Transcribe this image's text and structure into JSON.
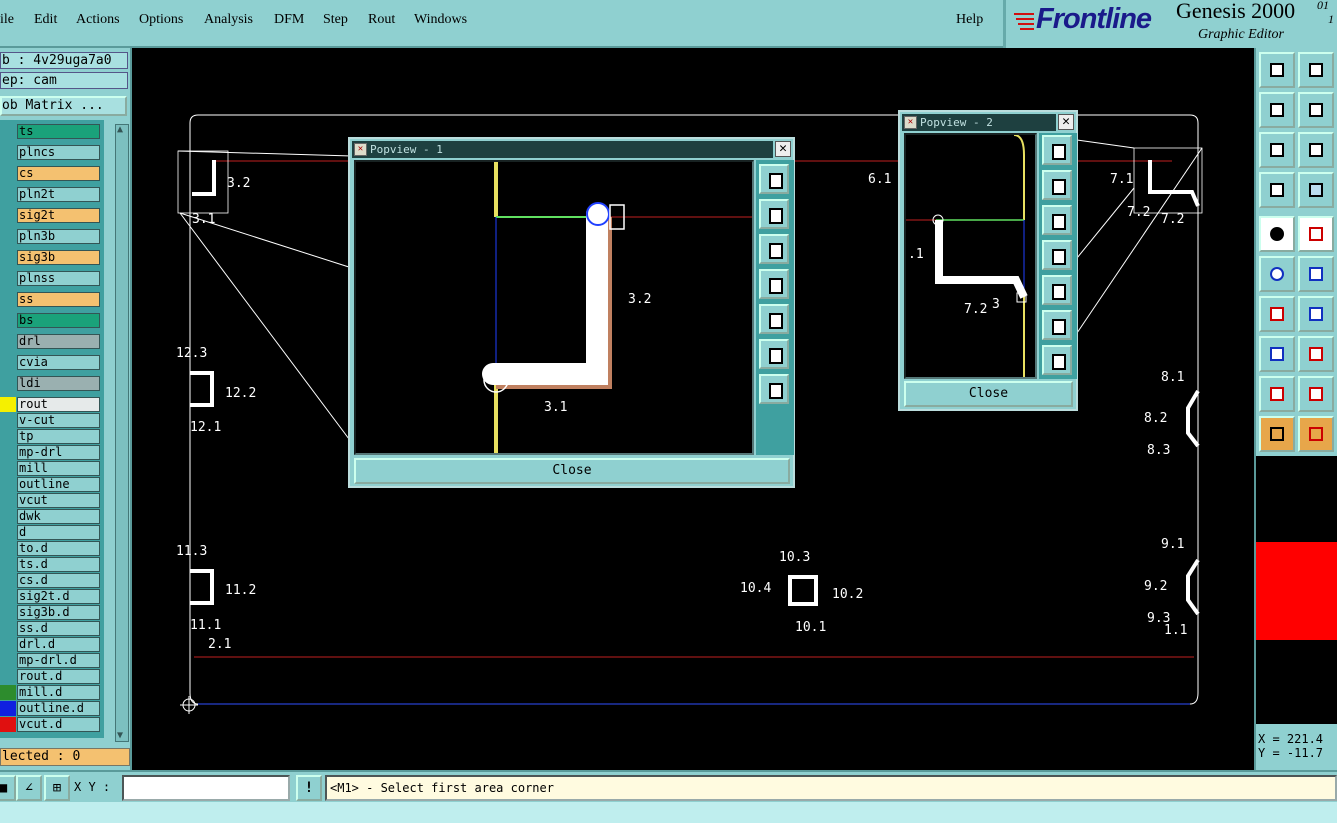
{
  "menu": [
    "File",
    "Edit",
    "Actions",
    "Options",
    "Analysis",
    "DFM",
    "Step",
    "Rout",
    "Windows"
  ],
  "menu_display": [
    "ile",
    "Edit",
    "Actions",
    "Options",
    "Analysis",
    "DFM",
    "Step",
    "Rout",
    "Windows"
  ],
  "help": "Help",
  "brand": {
    "logo": "Frontline",
    "product": "Genesis 2000",
    "ver1": "01",
    "ver2": "1",
    "subtitle": "Graphic Editor"
  },
  "left": {
    "job": "b : 4v29uga7a0",
    "step": "ep: cam",
    "matrix": "ob Matrix ...",
    "layers": [
      {
        "name": "ts",
        "color": "#1aa27a"
      },
      {
        "name": "plncs",
        "color": "#8fd0d0"
      },
      {
        "name": "cs",
        "color": "#f4c170"
      },
      {
        "name": "pln2t",
        "color": "#8fd0d0"
      },
      {
        "name": "sig2t",
        "color": "#f4c170"
      },
      {
        "name": "pln3b",
        "color": "#8fd0d0"
      },
      {
        "name": "sig3b",
        "color": "#f4c170"
      },
      {
        "name": "plnss",
        "color": "#8fd0d0"
      },
      {
        "name": "ss",
        "color": "#f4c170"
      },
      {
        "name": "bs",
        "color": "#1aa27a"
      },
      {
        "name": "drl",
        "color": "#9ab0b0"
      },
      {
        "name": "cvia",
        "color": "#8fd0d0"
      },
      {
        "name": "ldi",
        "color": "#9ab0b0"
      },
      {
        "name": "rout",
        "color": "#e6eaea"
      },
      {
        "name": "v-cut",
        "color": "#8fd0d0"
      },
      {
        "name": "tp",
        "color": "#8fd0d0"
      },
      {
        "name": "mp-drl",
        "color": "#8fd0d0"
      },
      {
        "name": "mill",
        "color": "#8fd0d0"
      },
      {
        "name": "outline",
        "color": "#8fd0d0"
      },
      {
        "name": "vcut",
        "color": "#8fd0d0"
      },
      {
        "name": "dwk",
        "color": "#8fd0d0"
      },
      {
        "name": "d",
        "color": "#8fd0d0"
      },
      {
        "name": "to.d",
        "color": "#8fd0d0"
      },
      {
        "name": "ts.d",
        "color": "#8fd0d0"
      },
      {
        "name": "cs.d",
        "color": "#8fd0d0"
      },
      {
        "name": "sig2t.d",
        "color": "#8fd0d0"
      },
      {
        "name": "sig3b.d",
        "color": "#8fd0d0"
      },
      {
        "name": "ss.d",
        "color": "#8fd0d0"
      },
      {
        "name": "drl.d",
        "color": "#8fd0d0"
      },
      {
        "name": "mp-drl.d",
        "color": "#8fd0d0"
      },
      {
        "name": "rout.d",
        "color": "#8fd0d0"
      },
      {
        "name": "mill.d",
        "color": "#8fd0d0"
      },
      {
        "name": "outline.d",
        "color": "#8fd0d0"
      },
      {
        "name": "vcut.d",
        "color": "#8fd0d0"
      }
    ],
    "swatches": {
      "rout": "#f5f000",
      "mill.d": "#2d8c2d",
      "outline.d": "#1020e0",
      "vcut.d": "#e01010"
    },
    "selected": "lected : 0"
  },
  "popview1": {
    "title": "Popview - 1",
    "close": "Close",
    "labels": {
      "a": "3.2",
      "b": "3.1"
    }
  },
  "popview2": {
    "title": "Popview - 2",
    "close": "Close",
    "labels": {
      "a": ".1",
      "b": "7.2",
      "c": "3"
    }
  },
  "canvas_labels": {
    "l32": "3.2",
    "l31": "3.1",
    "l61": "6.1",
    "l71": "7.1",
    "l72a": "7.2",
    "l72b": "7.2",
    "l123": "12.3",
    "l122": "12.2",
    "l121": "12.1",
    "l113": "11.3",
    "l112": "11.2",
    "l111": "11.1",
    "l21": "2.1",
    "l103": "10.3",
    "l104": "10.4",
    "l102": "10.2",
    "l101": "10.1",
    "l81": "8.1",
    "l82": "8.2",
    "l83": "8.3",
    "l91": "9.1",
    "l92": "9.2",
    "l93": "9.3",
    "l11": "1.1"
  },
  "coords": {
    "x": "X = 221.4",
    "y": "Y = -11.7"
  },
  "status": {
    "xy_label": "X Y :",
    "xy_value": "",
    "message": "<M1> - Select first area corner",
    "bang": "!"
  }
}
